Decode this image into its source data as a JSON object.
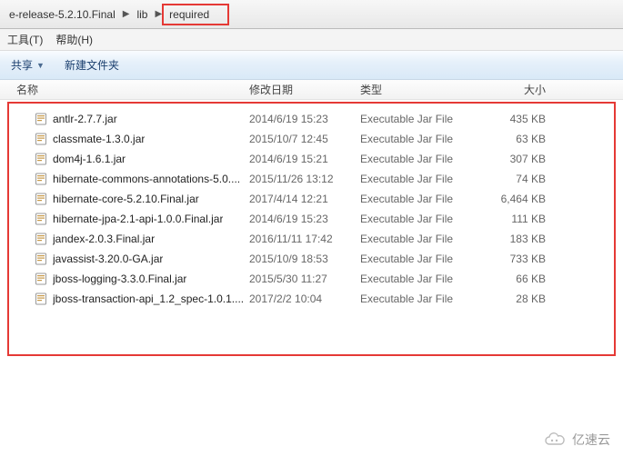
{
  "breadcrumb": {
    "seg0": "e-release-5.2.10.Final",
    "seg1": "lib",
    "seg2": "required"
  },
  "menu": {
    "tools": "工具(T)",
    "help": "帮助(H)"
  },
  "toolbar": {
    "share": "共享",
    "newfolder": "新建文件夹"
  },
  "columns": {
    "name": "名称",
    "date": "修改日期",
    "type": "类型",
    "size": "大小"
  },
  "files": [
    {
      "name": "antlr-2.7.7.jar",
      "date": "2014/6/19 15:23",
      "type": "Executable Jar File",
      "size": "435 KB"
    },
    {
      "name": "classmate-1.3.0.jar",
      "date": "2015/10/7 12:45",
      "type": "Executable Jar File",
      "size": "63 KB"
    },
    {
      "name": "dom4j-1.6.1.jar",
      "date": "2014/6/19 15:21",
      "type": "Executable Jar File",
      "size": "307 KB"
    },
    {
      "name": "hibernate-commons-annotations-5.0....",
      "date": "2015/11/26 13:12",
      "type": "Executable Jar File",
      "size": "74 KB"
    },
    {
      "name": "hibernate-core-5.2.10.Final.jar",
      "date": "2017/4/14 12:21",
      "type": "Executable Jar File",
      "size": "6,464 KB"
    },
    {
      "name": "hibernate-jpa-2.1-api-1.0.0.Final.jar",
      "date": "2014/6/19 15:23",
      "type": "Executable Jar File",
      "size": "111 KB"
    },
    {
      "name": "jandex-2.0.3.Final.jar",
      "date": "2016/11/11 17:42",
      "type": "Executable Jar File",
      "size": "183 KB"
    },
    {
      "name": "javassist-3.20.0-GA.jar",
      "date": "2015/10/9 18:53",
      "type": "Executable Jar File",
      "size": "733 KB"
    },
    {
      "name": "jboss-logging-3.3.0.Final.jar",
      "date": "2015/5/30 11:27",
      "type": "Executable Jar File",
      "size": "66 KB"
    },
    {
      "name": "jboss-transaction-api_1.2_spec-1.0.1....",
      "date": "2017/2/2 10:04",
      "type": "Executable Jar File",
      "size": "28 KB"
    }
  ],
  "watermark": {
    "text": "亿速云"
  }
}
